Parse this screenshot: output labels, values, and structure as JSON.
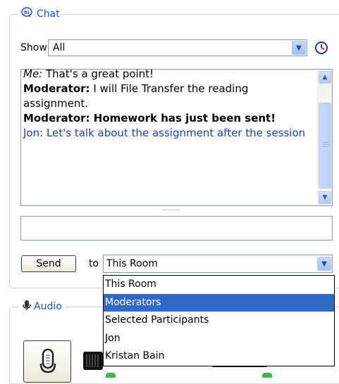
{
  "chat": {
    "title": "Chat",
    "show_label": "Show",
    "show_value": "All",
    "messages": [
      {
        "sender": "Me:",
        "text": " That's a great point!",
        "style": "italic-sender"
      },
      {
        "sender": "Moderator:",
        "text": " I will File Transfer the reading assignment.",
        "style": "bold-sender"
      },
      {
        "sender": "Moderator:",
        "text": " Homework has just been sent!",
        "style": "bold-all"
      },
      {
        "sender": "Jon:",
        "text": " Let's talk about the assignment after the session",
        "style": "blue"
      }
    ],
    "message_input_value": "",
    "send_label": "Send",
    "to_label": "to",
    "to_value": "This Room",
    "to_options": [
      "This Room",
      "Moderators",
      "Selected Participants",
      "Jon",
      "Kristan Bain"
    ],
    "to_selected_index": 1
  },
  "audio": {
    "title": "Audio"
  },
  "colors": {
    "legend_text": "#1a4fc4",
    "selection": "#316ac5",
    "jon_text": "#1a3fd8",
    "frame_border": "#7f9db9",
    "meter_green": "#3fb24a"
  },
  "icons": [
    "chat-icon",
    "clock-icon",
    "audio-icon",
    "microphone-icon",
    "chevron-down-icon",
    "chevron-up-icon"
  ]
}
